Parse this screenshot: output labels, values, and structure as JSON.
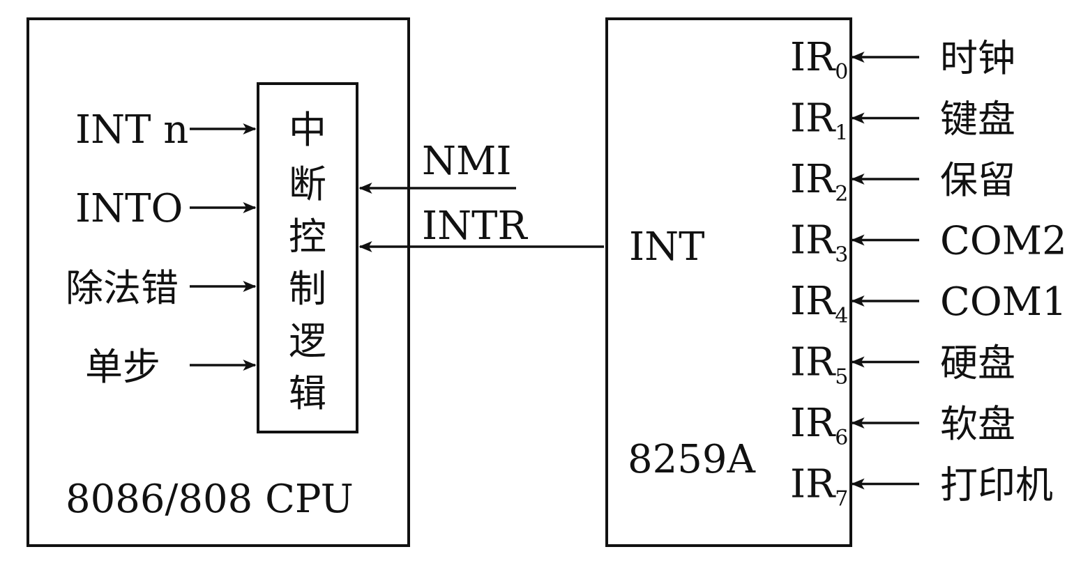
{
  "cpu": {
    "label": "8086/808 CPU",
    "control_logic_label": [
      "中",
      "断",
      "控",
      "制",
      "逻",
      "辑"
    ],
    "inputs": [
      "INT n",
      "INTO",
      "除法错",
      "单步"
    ]
  },
  "signals": {
    "nmi": "NMI",
    "intr": "INTR"
  },
  "pic": {
    "label": "8259A",
    "int_pin": "INT",
    "ir_prefix": "IR",
    "ir_lines": [
      {
        "sub": "0",
        "device": "时钟"
      },
      {
        "sub": "1",
        "device": "键盘"
      },
      {
        "sub": "2",
        "device": "保留"
      },
      {
        "sub": "3",
        "device": "COM2"
      },
      {
        "sub": "4",
        "device": "COM1"
      },
      {
        "sub": "5",
        "device": "硬盘"
      },
      {
        "sub": "6",
        "device": "软盘"
      },
      {
        "sub": "7",
        "device": "打印机"
      }
    ]
  }
}
